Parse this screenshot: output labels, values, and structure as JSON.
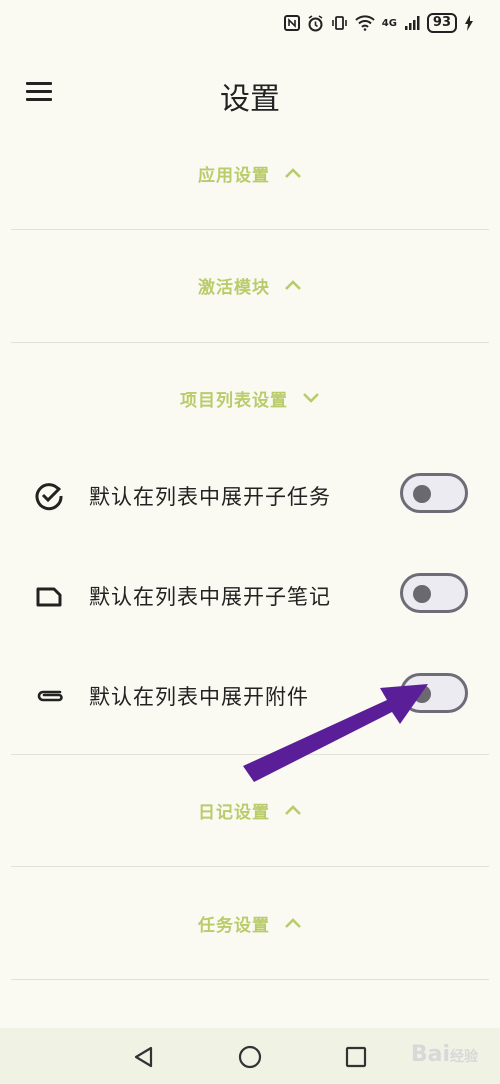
{
  "status_bar": {
    "faded_text": "",
    "network": "4G",
    "battery": "93"
  },
  "app_bar": {
    "title": "设置"
  },
  "sections": {
    "app": {
      "label": "应用设置",
      "expanded": false
    },
    "activate": {
      "label": "激活模块",
      "expanded": false
    },
    "project_list": {
      "label": "项目列表设置",
      "expanded": true
    },
    "journal": {
      "label": "日记设置",
      "expanded": false
    },
    "task": {
      "label": "任务设置",
      "expanded": false
    }
  },
  "project_list_items": [
    {
      "label": "默认在列表中展开子任务",
      "icon": "check-circle-icon",
      "enabled": false
    },
    {
      "label": "默认在列表中展开子笔记",
      "icon": "note-icon",
      "enabled": false
    },
    {
      "label": "默认在列表中展开附件",
      "icon": "attachment-icon",
      "enabled": false
    }
  ],
  "watermark": {
    "text": "Bai",
    "suffix": "经验"
  },
  "colors": {
    "background": "#fbfaf2",
    "section_header": "#b9cc6c",
    "arrow": "#5a1e99"
  }
}
